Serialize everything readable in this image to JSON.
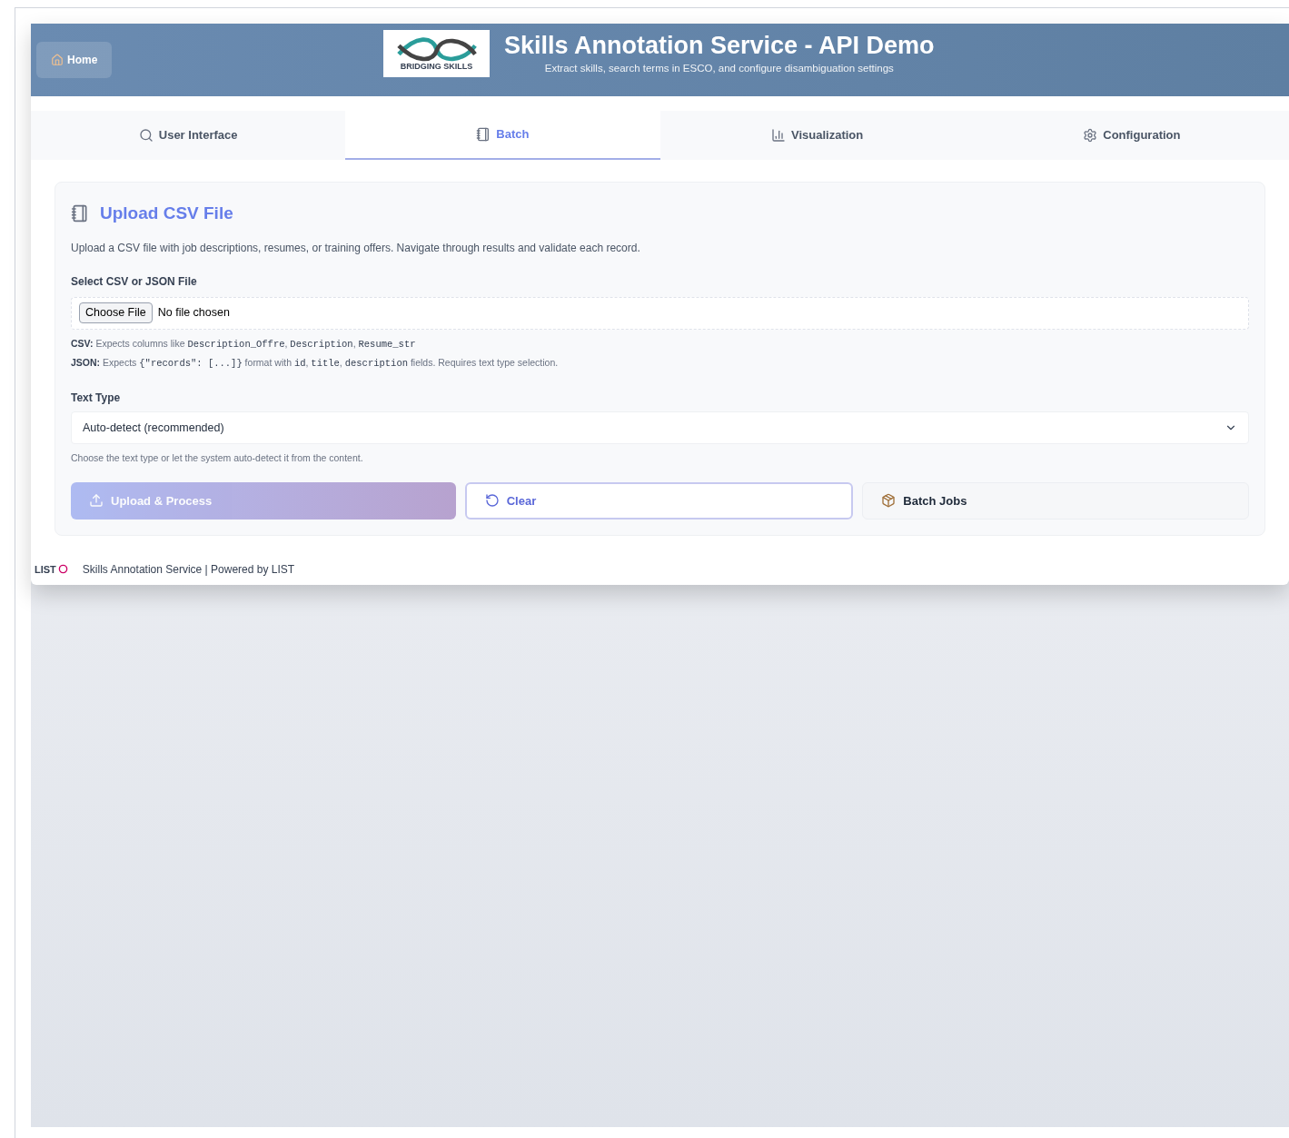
{
  "header": {
    "home_button": "Home",
    "title": "Skills Annotation Service - API Demo",
    "subtitle": "Extract skills, search terms in ESCO, and configure disambiguation settings",
    "logo_text": "BRIDGING SKILLS"
  },
  "tabs": [
    {
      "label": "User Interface",
      "selected": false
    },
    {
      "label": "Batch",
      "selected": true
    },
    {
      "label": "Visualization",
      "selected": false
    },
    {
      "label": "Configuration",
      "selected": false
    }
  ],
  "card": {
    "title": "Upload CSV File",
    "description": "Upload a CSV file with job descriptions, resumes, or training offers. Navigate through results and validate each record.",
    "file_label": "Select CSV or JSON File",
    "file_button": "Choose File",
    "file_status": "No file chosen",
    "hints": [
      [
        {
          "kind": "bold",
          "text": "CSV:"
        },
        {
          "kind": "plain",
          "text": " Expects columns like "
        },
        {
          "kind": "code",
          "text": "Description_Offre"
        },
        {
          "kind": "plain",
          "text": ", "
        },
        {
          "kind": "code",
          "text": "Description"
        },
        {
          "kind": "plain",
          "text": ", "
        },
        {
          "kind": "code",
          "text": "Resume_str"
        }
      ],
      [
        {
          "kind": "bold",
          "text": "JSON:"
        },
        {
          "kind": "plain",
          "text": " Expects "
        },
        {
          "kind": "code",
          "text": "{\"records\": [...]}"
        },
        {
          "kind": "plain",
          "text": " format with "
        },
        {
          "kind": "code",
          "text": "id"
        },
        {
          "kind": "plain",
          "text": ", "
        },
        {
          "kind": "code",
          "text": "title"
        },
        {
          "kind": "plain",
          "text": ", "
        },
        {
          "kind": "code",
          "text": "description"
        },
        {
          "kind": "plain",
          "text": " fields. Requires text type selection."
        }
      ]
    ],
    "text_type_label": "Text Type",
    "text_type_value": "Auto-detect (recommended)",
    "text_type_hint": "Choose the text type or let the system auto-detect it from the content.",
    "buttons": [
      {
        "kind": "primary",
        "label": "Upload & Process",
        "disabled": true
      },
      {
        "kind": "outline",
        "label": "Clear",
        "disabled": false
      },
      {
        "kind": "secondary",
        "label": "Batch Jobs",
        "disabled": false
      }
    ]
  },
  "footer": {
    "logo_text": "LIST",
    "text": "Skills Annotation Service | Powered by LIST"
  }
}
